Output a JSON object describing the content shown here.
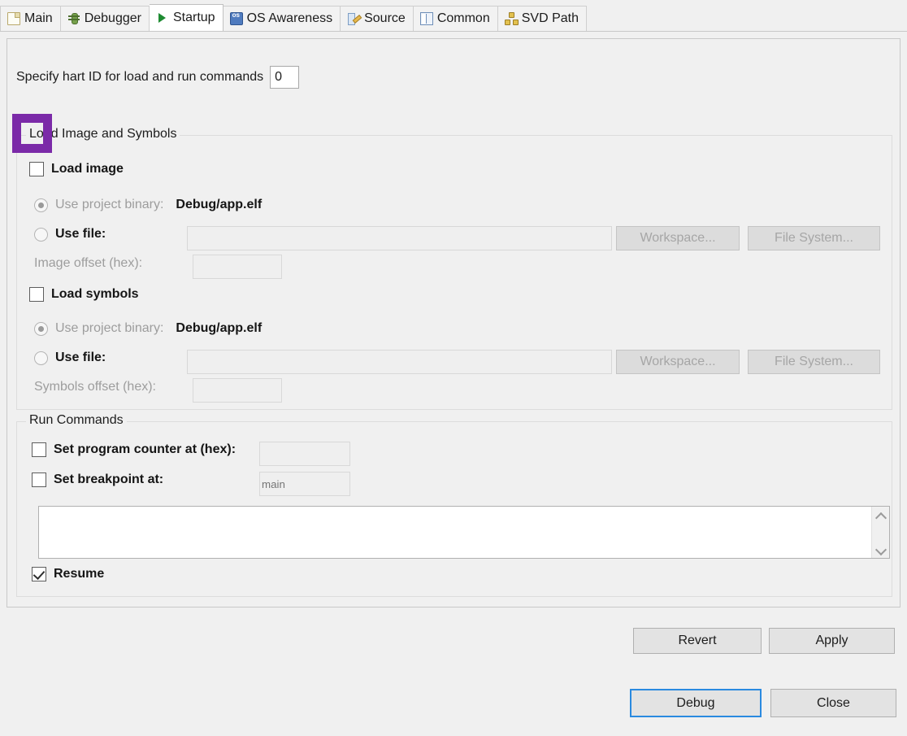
{
  "tabs": [
    {
      "label": "Main",
      "icon": "file-icon",
      "active": false
    },
    {
      "label": "Debugger",
      "icon": "bug-icon",
      "active": false
    },
    {
      "label": "Startup",
      "icon": "play-icon",
      "active": true
    },
    {
      "label": "OS Awareness",
      "icon": "os-icon",
      "active": false
    },
    {
      "label": "Source",
      "icon": "source-icon",
      "active": false
    },
    {
      "label": "Common",
      "icon": "common-icon",
      "active": false
    },
    {
      "label": "SVD Path",
      "icon": "svd-path-icon",
      "active": false
    }
  ],
  "hart": {
    "label": "Specify hart ID for load and run commands",
    "value": "0"
  },
  "load_group": {
    "title": "Load Image and Symbols",
    "load_image": {
      "checkbox_label": "Load image",
      "checked": false,
      "project_binary_label": "Use project binary:",
      "project_binary_value": "Debug/app.elf",
      "use_file_label": "Use file:",
      "use_file_value": "",
      "workspace_button": "Workspace...",
      "file_system_button": "File System...",
      "offset_label": "Image offset (hex):",
      "offset_value": ""
    },
    "load_symbols": {
      "checkbox_label": "Load symbols",
      "checked": false,
      "project_binary_label": "Use project binary:",
      "project_binary_value": "Debug/app.elf",
      "use_file_label": "Use file:",
      "use_file_value": "",
      "workspace_button": "Workspace...",
      "file_system_button": "File System...",
      "offset_label": "Symbols offset (hex):",
      "offset_value": ""
    }
  },
  "run_group": {
    "title": "Run Commands",
    "set_pc": {
      "label": "Set program counter at (hex):",
      "checked": false,
      "value": ""
    },
    "set_breakpoint": {
      "label": "Set breakpoint at:",
      "checked": false,
      "value": "",
      "placeholder": "main"
    },
    "commands_text": "",
    "resume": {
      "label": "Resume",
      "checked": true
    },
    "scroll_up_icon": "chevron-up-icon",
    "scroll_down_icon": "chevron-down-icon"
  },
  "footer": {
    "revert": "Revert",
    "apply": "Apply",
    "debug": "Debug",
    "close": "Close"
  },
  "highlight": {
    "target": "load-image-checkbox",
    "color": "#7b2aa8"
  }
}
